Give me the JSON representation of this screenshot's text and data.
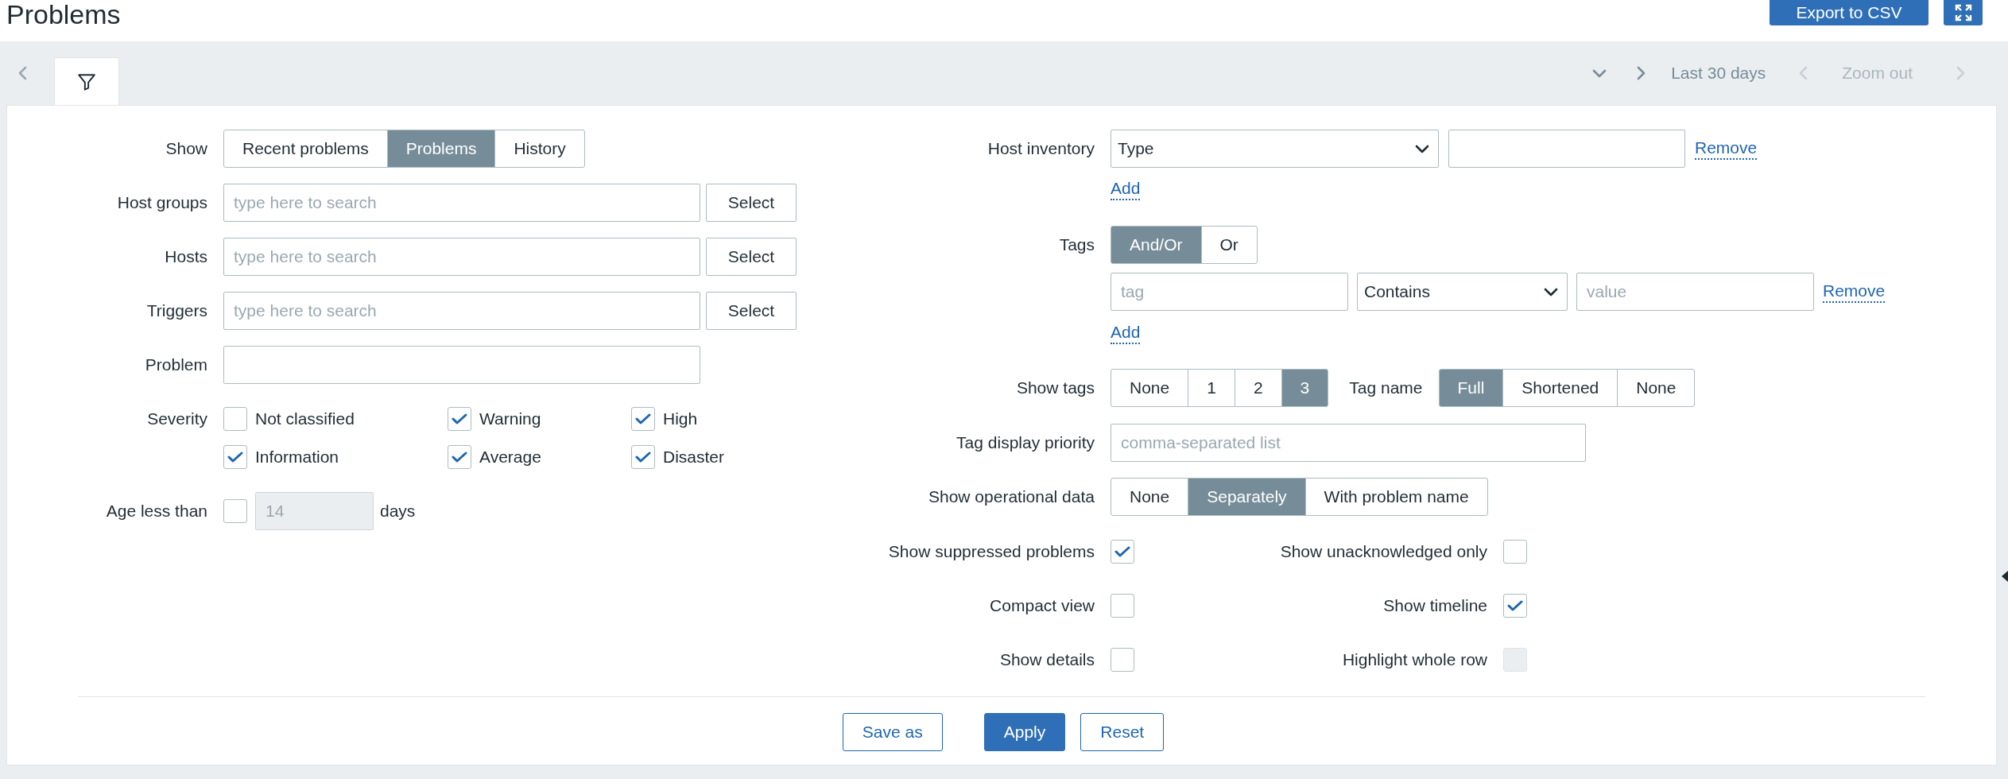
{
  "page": {
    "title": "Problems",
    "export_button": "Export to CSV"
  },
  "timebar": {
    "range": "Last 30 days",
    "zoom_out": "Zoom out"
  },
  "filter": {
    "show": {
      "label": "Show",
      "options": [
        {
          "label": "Recent problems",
          "selected": false
        },
        {
          "label": "Problems",
          "selected": true
        },
        {
          "label": "History",
          "selected": false
        }
      ]
    },
    "multiselects": [
      {
        "label": "Host groups",
        "placeholder": "type here to search",
        "button": "Select"
      },
      {
        "label": "Hosts",
        "placeholder": "type here to search",
        "button": "Select"
      },
      {
        "label": "Triggers",
        "placeholder": "type here to search",
        "button": "Select"
      }
    ],
    "problem": {
      "label": "Problem"
    },
    "severity": {
      "label": "Severity",
      "options": [
        {
          "label": "Not classified",
          "checked": false
        },
        {
          "label": "Warning",
          "checked": true
        },
        {
          "label": "High",
          "checked": true
        },
        {
          "label": "Information",
          "checked": true
        },
        {
          "label": "Average",
          "checked": true
        },
        {
          "label": "Disaster",
          "checked": true
        }
      ]
    },
    "age": {
      "label": "Age less than",
      "checked": false,
      "value": "14",
      "disabled": true,
      "unit": "days"
    },
    "host_inventory": {
      "label": "Host inventory",
      "field": "Type",
      "remove": "Remove",
      "add": "Add"
    },
    "tags": {
      "label": "Tags",
      "operator": [
        {
          "label": "And/Or",
          "selected": true
        },
        {
          "label": "Or",
          "selected": false
        }
      ],
      "rows": [
        {
          "tag_placeholder": "tag",
          "operator": "Contains",
          "value_placeholder": "value",
          "remove": "Remove"
        }
      ],
      "add": "Add"
    },
    "show_tags": {
      "label": "Show tags",
      "options": [
        {
          "label": "None",
          "selected": false
        },
        {
          "label": "1",
          "selected": false
        },
        {
          "label": "2",
          "selected": false
        },
        {
          "label": "3",
          "selected": true
        }
      ]
    },
    "tag_name": {
      "label": "Tag name",
      "options": [
        {
          "label": "Full",
          "selected": true
        },
        {
          "label": "Shortened",
          "selected": false
        },
        {
          "label": "None",
          "selected": false
        }
      ]
    },
    "tag_display_priority": {
      "label": "Tag display priority",
      "placeholder": "comma-separated list"
    },
    "show_operational_data": {
      "label": "Show operational data",
      "options": [
        {
          "label": "None",
          "selected": false
        },
        {
          "label": "Separately",
          "selected": true
        },
        {
          "label": "With problem name",
          "selected": false
        }
      ]
    },
    "toggles": [
      {
        "label": "Show suppressed problems",
        "checked": true,
        "disabled": false
      },
      {
        "label": "Show unacknowledged only",
        "checked": false,
        "disabled": false
      },
      {
        "label": "Compact view",
        "checked": false,
        "disabled": false
      },
      {
        "label": "Show timeline",
        "checked": true,
        "disabled": false
      },
      {
        "label": "Show details",
        "checked": false,
        "disabled": false
      },
      {
        "label": "Highlight whole row",
        "checked": false,
        "disabled": true
      }
    ],
    "actions": [
      {
        "label": "Save as",
        "kind": "outline"
      },
      {
        "label": "Apply",
        "kind": "primary"
      },
      {
        "label": "Reset",
        "kind": "outline"
      }
    ]
  }
}
